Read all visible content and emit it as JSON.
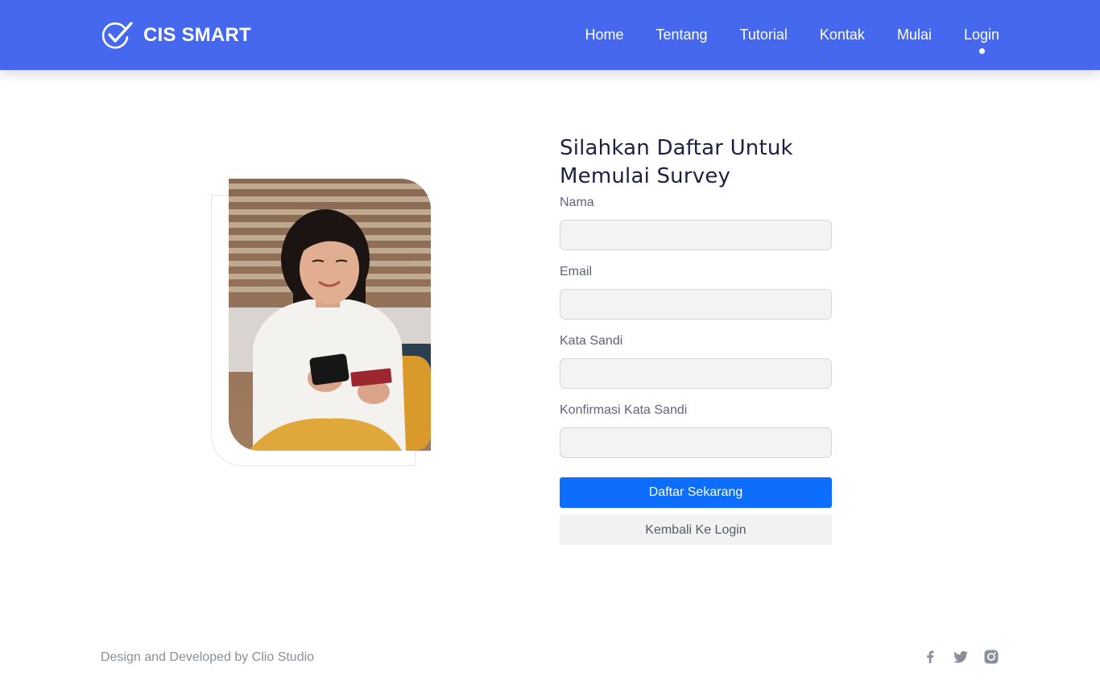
{
  "brand": {
    "name": "CIS SMART",
    "icon": "check-circle-icon"
  },
  "nav": {
    "items": [
      {
        "label": "Home"
      },
      {
        "label": "Tentang"
      },
      {
        "label": "Tutorial"
      },
      {
        "label": "Kontak"
      },
      {
        "label": "Mulai"
      },
      {
        "label": "Login"
      }
    ],
    "active": "Login"
  },
  "form": {
    "title": "Silahkan Daftar Untuk Memulai Survey",
    "fields": [
      {
        "label": "Nama",
        "value": "",
        "placeholder": ""
      },
      {
        "label": "Email",
        "value": "",
        "placeholder": ""
      },
      {
        "label": "Kata Sandi",
        "value": "",
        "placeholder": ""
      },
      {
        "label": "Konfirmasi Kata Sandi",
        "value": "",
        "placeholder": ""
      }
    ],
    "submit_label": "Daftar Sekarang",
    "back_label": "Kembali Ke Login"
  },
  "footer": {
    "credit": "Design and Developed by Clio Studio",
    "social_icons": [
      "facebook-icon",
      "twitter-icon",
      "instagram-icon"
    ]
  },
  "colors": {
    "navbar": "#4568ef",
    "primary_button": "#0d6efd",
    "input_bg": "#f3f3f3"
  }
}
